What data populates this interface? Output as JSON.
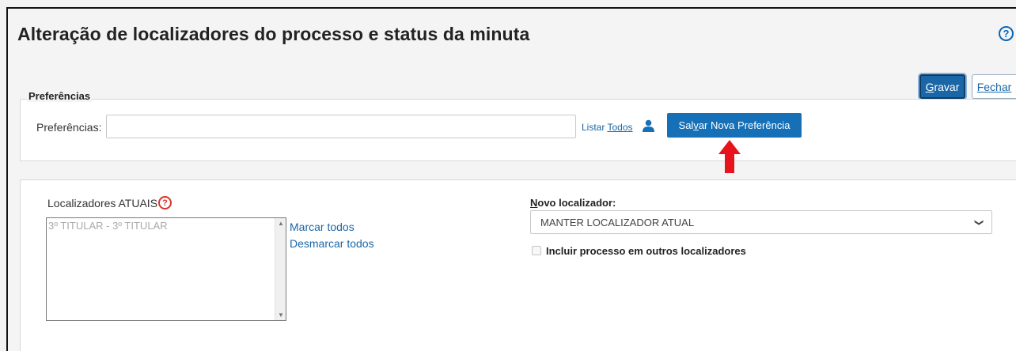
{
  "page": {
    "title": "Alteração de localizadores do processo e status da minuta",
    "help_icon": "question-circle-icon"
  },
  "toolbar": {
    "gravar_label_ul": "G",
    "gravar_label_rest": "ravar",
    "fechar_label_ul": "F",
    "fechar_label_rest": "echar"
  },
  "preferencias": {
    "legend": "Preferências",
    "label": "Preferências:",
    "input_value": "",
    "listar_prefix": "Listar ",
    "listar_ul": "T",
    "listar_rest": "odos",
    "user_icon": "user-icon",
    "salvar_prefix": "Sal",
    "salvar_ul": "v",
    "salvar_rest": "ar Nova Preferência",
    "arrow_icon": "red-arrow-up-icon"
  },
  "localizadores": {
    "label": "Localizadores ATUAIS",
    "items": [
      "3º TITULAR - 3º TITULAR"
    ],
    "marcar_todos": "Marcar todos",
    "desmarcar_todos": "Desmarcar todos"
  },
  "novo": {
    "label_ul": "N",
    "label_rest": "ovo localizador:",
    "selected": "MANTER LOCALIZADOR ATUAL",
    "checkbox_label": "Incluir processo em outros localizadores",
    "checkbox_checked": false
  },
  "colors": {
    "primary": "#1570b8",
    "link": "#1a66a6",
    "arrow": "#e8141b",
    "help_red": "#d9342b"
  }
}
